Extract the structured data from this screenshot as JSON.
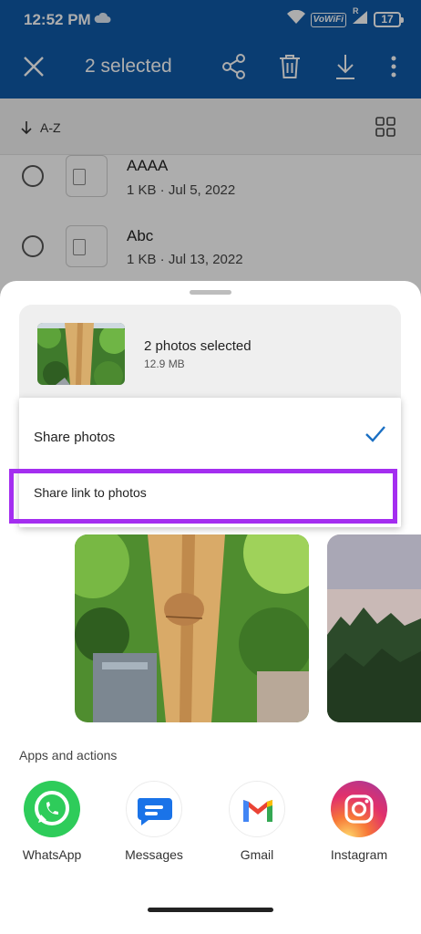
{
  "status_bar": {
    "time": "12:52 PM",
    "vowifi_label": "VoWiFi",
    "signal_label": "R",
    "battery": "17"
  },
  "app_bar": {
    "title": "2 selected",
    "background": "#0f5aa9"
  },
  "list": {
    "sort_label": "A-Z",
    "items": [
      {
        "name": "AAAA",
        "meta": "1 KB · Jul 5, 2022"
      },
      {
        "name": "Abc",
        "meta": "1 KB · Jul 13, 2022"
      }
    ]
  },
  "share_sheet": {
    "selection_title": "2 photos selected",
    "selection_size": "12.9 MB",
    "options": [
      {
        "label": "Share photos",
        "selected": true
      },
      {
        "label": "Share link to photos",
        "selected": false
      }
    ],
    "highlight_color": "#a42ef0",
    "apps_title": "Apps and actions",
    "apps": [
      {
        "label": "WhatsApp",
        "icon": "whatsapp-icon"
      },
      {
        "label": "Messages",
        "icon": "messages-icon"
      },
      {
        "label": "Gmail",
        "icon": "gmail-icon"
      },
      {
        "label": "Instagram",
        "icon": "instagram-icon"
      }
    ]
  }
}
